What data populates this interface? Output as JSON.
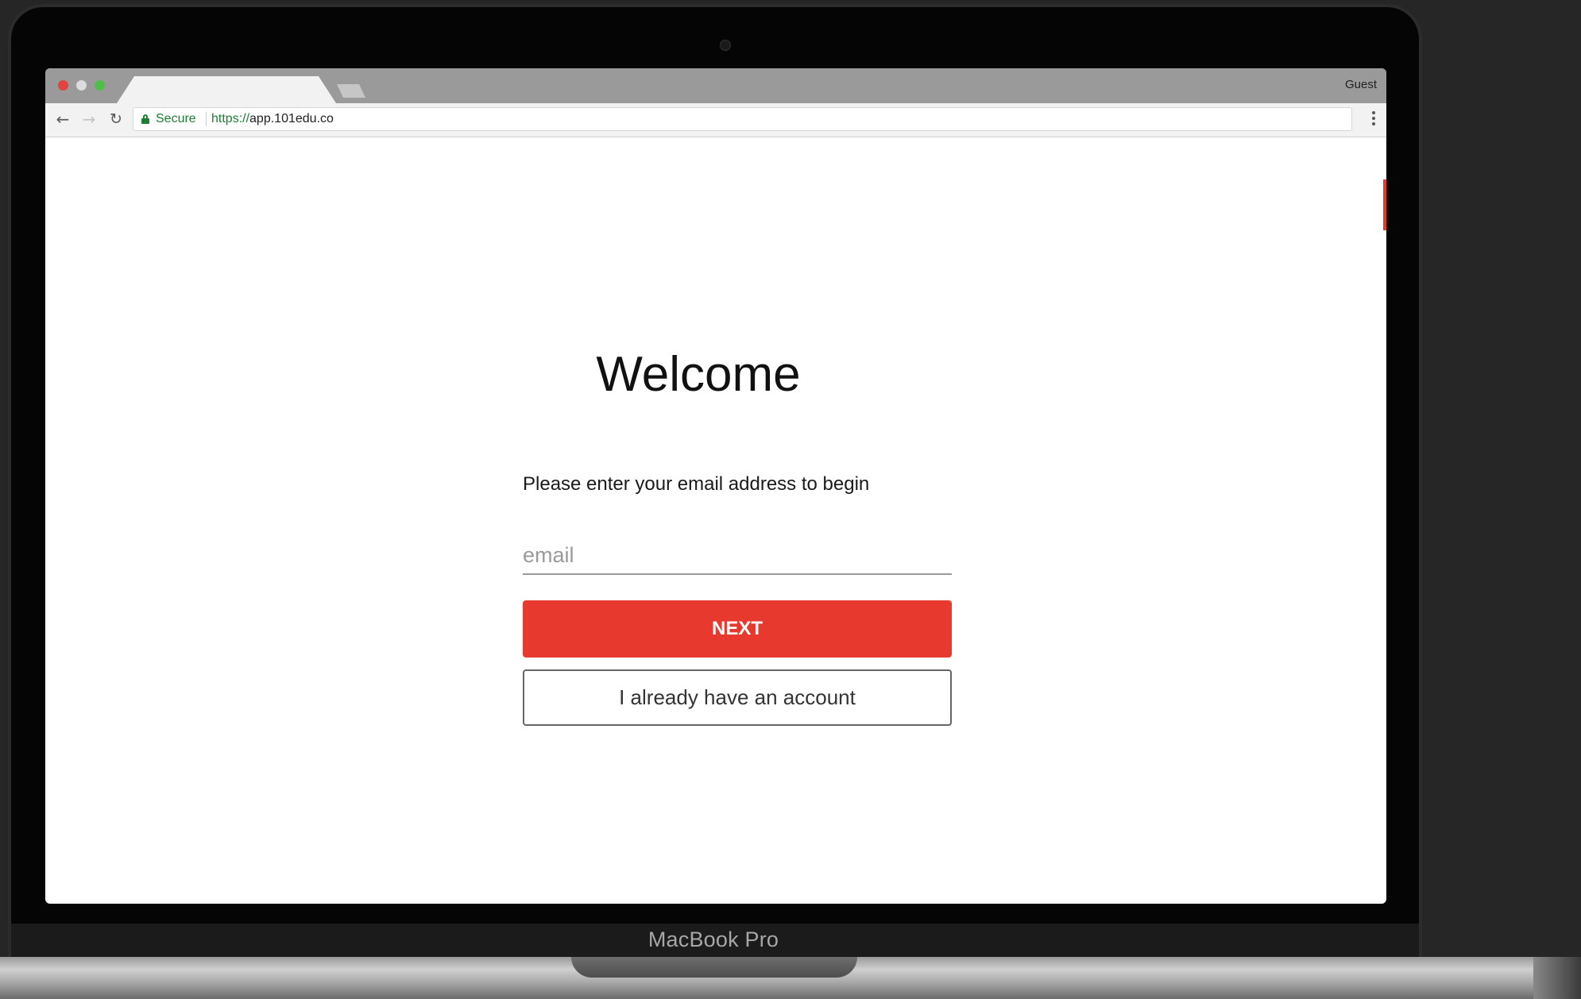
{
  "device": {
    "brand_label": "MacBook Pro"
  },
  "browser": {
    "profile_label": "Guest",
    "security_label": "Secure",
    "url_scheme": "https://",
    "url_host": "app.101edu.co",
    "back_icon": "arrow-left-icon",
    "forward_icon": "arrow-right-icon",
    "reload_icon": "reload-icon",
    "menu_icon": "more-vertical-icon",
    "lock_icon": "lock-icon"
  },
  "page": {
    "title": "Welcome",
    "subtitle": "Please enter your email address to begin",
    "email_placeholder": "email",
    "email_value": "",
    "next_label": "NEXT",
    "account_label": "I already have an account"
  },
  "colors": {
    "accent": "#e8392f",
    "secure_green": "#1e7e34"
  }
}
